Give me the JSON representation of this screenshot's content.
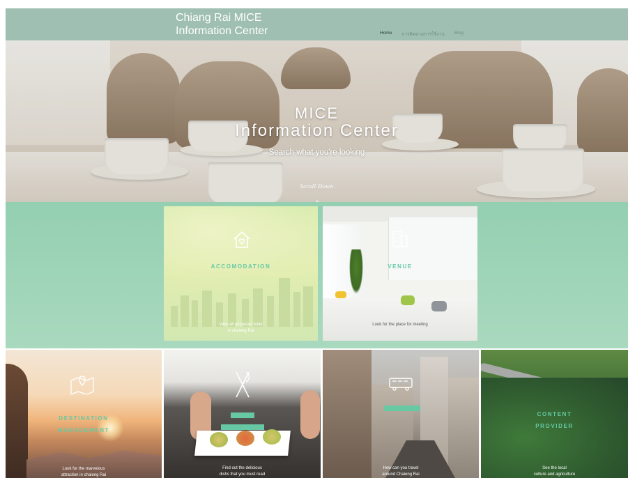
{
  "header": {
    "site_title": "Chiang Rai MICE\nInformation Center",
    "nav": [
      "Home",
      "การติดตามการใช้งาน",
      "Blog"
    ],
    "active_nav": "Home"
  },
  "hero": {
    "line1": "MICE",
    "line2": "Information Center",
    "subtitle": "Search what you're looking",
    "scroll": "Scroll Down"
  },
  "tiles": {
    "accommodation": {
      "label": "ACCOMODATION",
      "desc": "View all gorgeous hotel\nin chaieng Rai",
      "icon": "house-icon"
    },
    "venue": {
      "label": "VENUE",
      "desc": "Look for the place for meeting",
      "icon": "building-icon"
    },
    "destination": {
      "label1": "DESTINATION",
      "label2": "MANAGEMENT",
      "desc": "Look for the marvelous\nattraction in chaieng Rai",
      "icon": "map-icon"
    },
    "food": {
      "label": "",
      "desc": "Find out the delicious\ndishs that you must read",
      "icon": "fork-knife-icon"
    },
    "transport": {
      "label": "",
      "desc": "How can you travel\naround Chaieng Rai",
      "icon": "bus-icon"
    },
    "content": {
      "label1": "CONTENT",
      "label2": "PROVIDER",
      "desc": "See the local\nculture and agriculture",
      "icon": "leaf-icon"
    }
  },
  "colors": {
    "header_bg": "#9fbfb2",
    "band": "#a9d9be",
    "accent": "#66c9a4"
  }
}
